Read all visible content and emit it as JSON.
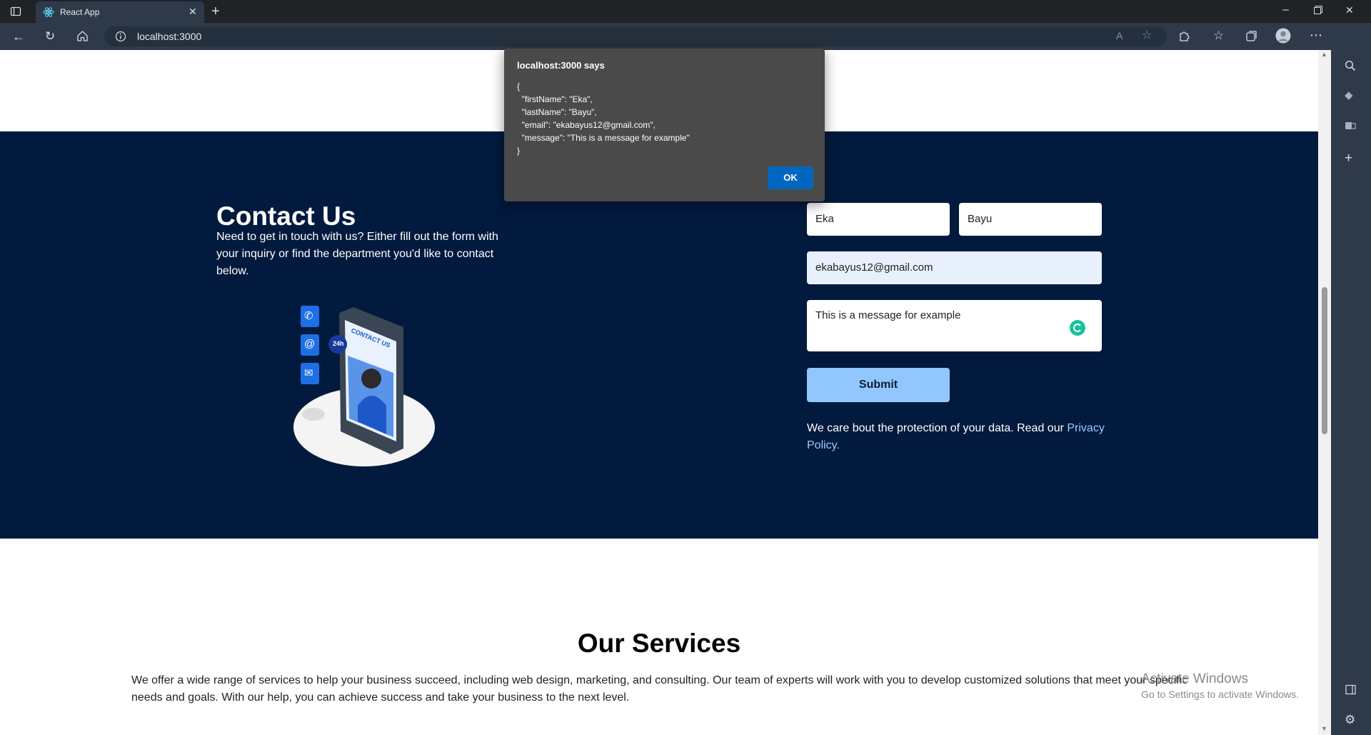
{
  "browser": {
    "tab_title": "React App",
    "url": "localhost:3000",
    "icons": {
      "tab_actions": "tab-actions-icon",
      "new_tab": "plus-icon",
      "back": "back-arrow-icon",
      "reload": "reload-icon",
      "home": "home-icon",
      "site_info": "info-icon",
      "read_aloud": "read-aloud-icon",
      "favorite": "add-favorite-icon",
      "extensions": "puzzle-icon",
      "favorites": "favorites-icon",
      "collections": "collections-icon",
      "profile": "profile-icon",
      "menu": "more-icon",
      "copilot": "bing-icon"
    }
  },
  "dialog": {
    "title": "localhost:3000 says",
    "body": "{\n  \"firstName\": \"Eka\",\n  \"lastName\": \"Bayu\",\n  \"email\": \"ekabayus12@gmail.com\",\n  \"message\": \"This is a message for example\"\n}",
    "ok_label": "OK"
  },
  "contact": {
    "title": "Contact Us",
    "description": "Need to get in touch with us? Either fill out the form with your inquiry or find the department you'd like to contact below.",
    "first_name": "Eka",
    "last_name": "Bayu",
    "email": "ekabayus12@gmail.com",
    "message": "This is a message for example",
    "submit_label": "Submit",
    "privacy_text": "We care bout the protection of your data. Read our",
    "privacy_link": "Privacy Policy.",
    "illustration_text": "CONTACT US",
    "badge_text": "24h"
  },
  "services": {
    "title": "Our Services",
    "description": "We offer a wide range of services to help your business succeed, including web design, marketing, and consulting. Our team of experts will work with you to develop customized solutions that meet your specific needs and goals. With our help, you can achieve success and take your business to the next level."
  },
  "watermark": {
    "title": "Activate Windows",
    "subtitle": "Go to Settings to activate Windows."
  },
  "colors": {
    "contact_bg": "#021a3d",
    "submit_bg": "#91c7fc",
    "dialog_bg": "#4a4a4a",
    "ok_button": "#0067c0",
    "link": "#9ecbff"
  }
}
